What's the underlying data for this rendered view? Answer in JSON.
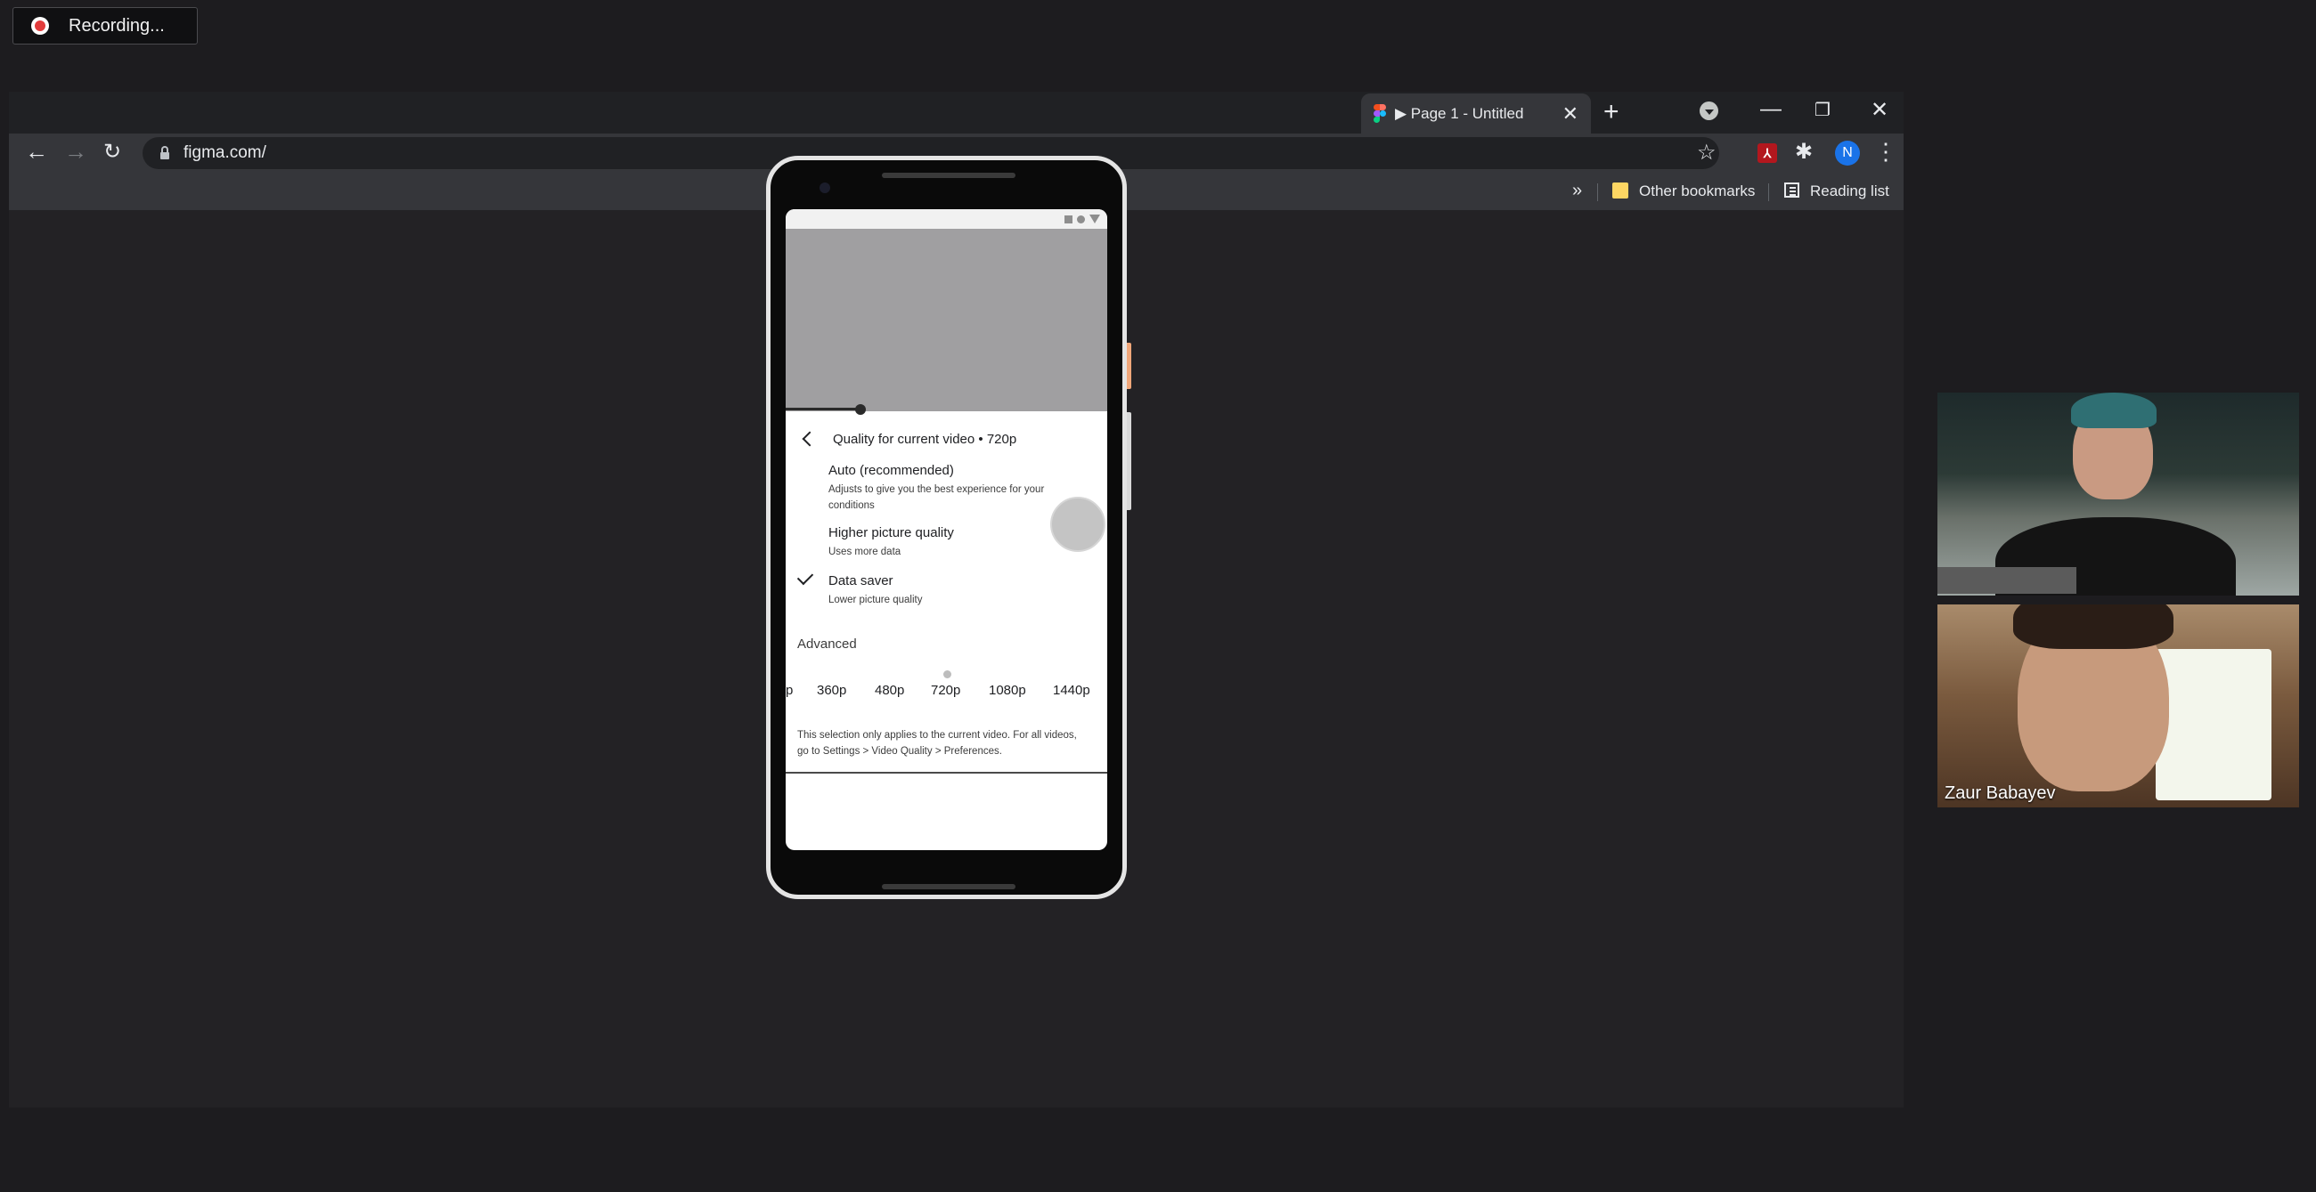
{
  "recording": {
    "label": "Recording..."
  },
  "browser": {
    "tab_title": "▶ Page 1 - Untitled",
    "url": "figma.com/",
    "profile_initial": "N",
    "bookmarks": {
      "overflow": "»",
      "other": "Other bookmarks",
      "reading_list": "Reading list"
    }
  },
  "phone": {
    "sheet_title": "Quality for current video • 720p",
    "options": [
      {
        "title": "Auto (recommended)",
        "subtitle": "Adjusts to give you the best experience for your conditions",
        "selected": false
      },
      {
        "title": "Higher picture quality",
        "subtitle": "Uses more data",
        "selected": false
      },
      {
        "title": "Data saver",
        "subtitle": "Lower picture quality",
        "selected": true
      }
    ],
    "advanced_label": "Advanced",
    "resolutions": [
      "p",
      "360p",
      "480p",
      "720p",
      "1080p",
      "1440p"
    ],
    "note": "This selection only applies to the current video. For all videos, go to Settings > Video Quality > Preferences."
  },
  "participants": [
    {
      "name": ""
    },
    {
      "name": "Zaur Babayev"
    }
  ],
  "colors": {
    "figma_red": "#f24e1e",
    "figma_purple": "#a259ff",
    "figma_blue": "#1abcfe",
    "figma_green": "#0acf83",
    "profile_blue": "#1a73e8"
  }
}
